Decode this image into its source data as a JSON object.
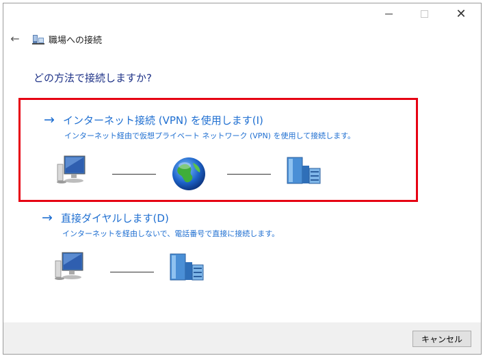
{
  "window": {
    "title": "職場への接続"
  },
  "heading": "どの方法で接続しますか?",
  "options": [
    {
      "title": "インターネット接続 (VPN) を使用します(I)",
      "description": "インターネット経由で仮想プライベート ネットワーク (VPN) を使用して接続します。",
      "highlighted": true
    },
    {
      "title": "直接ダイヤルします(D)",
      "description": "インターネットを経由しないで、電話番号で直接に接続します。",
      "highlighted": false
    }
  ],
  "footer": {
    "cancel_label": "キャンセル"
  },
  "icons": {
    "back": "back-arrow-icon",
    "network": "network-folder-icon",
    "computer": "computer-icon",
    "globe": "globe-icon",
    "server": "server-building-icon",
    "option_arrow": "right-arrow-icon"
  },
  "colors": {
    "link": "#1f6fd1",
    "heading": "#1e3287",
    "highlight_border": "#e60012",
    "footer_bg": "#f0f0f0"
  }
}
